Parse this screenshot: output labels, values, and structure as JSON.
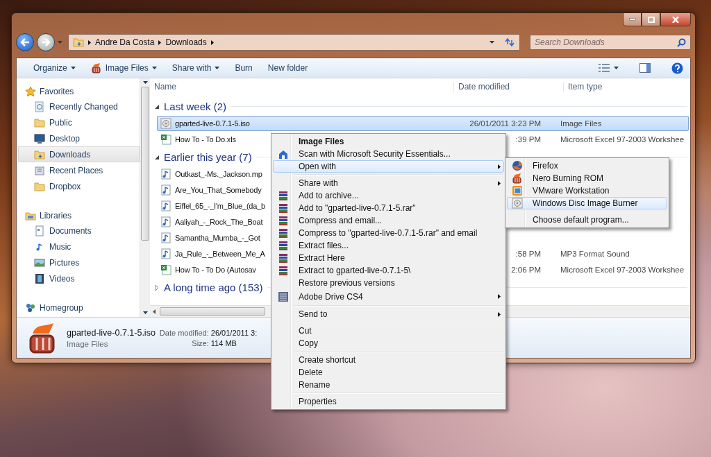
{
  "nav": {
    "breadcrumb": [
      "Andre Da Costa",
      "Downloads"
    ],
    "search": {
      "placeholder": "Search Downloads"
    }
  },
  "toolbar": {
    "items": [
      {
        "label": "Organize",
        "kind": "plain",
        "dropdown": true
      },
      {
        "label": "Image Files",
        "kind": "burner",
        "dropdown": true
      },
      {
        "label": "Share with",
        "kind": "plain",
        "dropdown": true
      },
      {
        "label": "Burn",
        "kind": "plain",
        "dropdown": false
      },
      {
        "label": "New folder",
        "kind": "plain",
        "dropdown": false
      }
    ]
  },
  "sidebar": {
    "sections": [
      {
        "title": "Favorites",
        "kind": "star",
        "items": [
          {
            "label": "Recently Changed",
            "kind": "recent",
            "selected": false
          },
          {
            "label": "Public",
            "kind": "folder",
            "selected": false
          },
          {
            "label": "Desktop",
            "kind": "desktop",
            "selected": false
          },
          {
            "label": "Downloads",
            "kind": "download",
            "selected": true
          },
          {
            "label": "Recent Places",
            "kind": "places",
            "selected": false
          },
          {
            "label": "Dropbox",
            "kind": "folder",
            "selected": false
          }
        ]
      },
      {
        "title": "Libraries",
        "kind": "library",
        "items": [
          {
            "label": "Documents",
            "kind": "document",
            "selected": false
          },
          {
            "label": "Music",
            "kind": "music",
            "selected": false
          },
          {
            "label": "Pictures",
            "kind": "pictures",
            "selected": false
          },
          {
            "label": "Videos",
            "kind": "videos",
            "selected": false
          }
        ]
      },
      {
        "title": "Homegroup",
        "kind": "homegroup"
      }
    ]
  },
  "list": {
    "columns": [
      "Name",
      "Date modified",
      "Item type"
    ],
    "groups": [
      {
        "title": "Last week (2)",
        "expanded": true,
        "files": [
          {
            "name": "gparted-live-0.7.1-5.iso",
            "date": "26/01/2011 3:23 PM",
            "type": "Image Files",
            "kind": "disc",
            "selected": true
          },
          {
            "name": "How To - To Do.xls",
            "date": ":39 PM",
            "type": "Microsoft Excel 97-2003 Workshee",
            "kind": "excel",
            "selected": false
          }
        ]
      },
      {
        "title": "Earlier this year (7)",
        "expanded": true,
        "files": [
          {
            "name": "Outkast_-Ms._Jackson.mp",
            "kind": "audio",
            "selected": false
          },
          {
            "name": "Are_You_That_Somebody",
            "kind": "audio",
            "selected": false
          },
          {
            "name": "Eiffel_65_-_I'm_Blue_(da_b",
            "kind": "audio",
            "selected": false
          },
          {
            "name": "Aaliyah_-_Rock_The_Boat",
            "kind": "audio",
            "selected": false
          },
          {
            "name": "Samantha_Mumba_-_Got",
            "kind": "audio",
            "selected": false
          },
          {
            "name": "Ja_Rule_-_Between_Me_A",
            "date": ":58 PM",
            "type": "MP3 Format Sound",
            "kind": "audio",
            "selected": false
          },
          {
            "name": "How To - To Do (Autosav",
            "date": "2:06 PM",
            "type": "Microsoft Excel 97-2003 Workshee",
            "kind": "excel",
            "selected": false
          }
        ]
      },
      {
        "title": "A long time ago (153)",
        "expanded": false
      }
    ]
  },
  "details": {
    "name": "gparted-live-0.7.1-5.iso",
    "type": "Image Files",
    "fields": [
      {
        "label": "Date modified:",
        "value": "26/01/2011 3:"
      },
      {
        "label": "Size:",
        "value": "114 MB"
      }
    ]
  },
  "context_menu": {
    "sections": [
      {
        "items": [
          {
            "label": "Image Files",
            "kind": "default",
            "submenu": false,
            "selected": false
          },
          {
            "label": "Scan with Microsoft Security Essentials...",
            "kind": "shield",
            "submenu": false,
            "selected": false
          },
          {
            "label": "Open with",
            "kind": "plain",
            "submenu": true,
            "selected": true
          }
        ]
      },
      {
        "items": [
          {
            "label": "Share with",
            "kind": "plain",
            "submenu": true,
            "selected": false
          },
          {
            "label": "Add to archive...",
            "kind": "archive",
            "submenu": false,
            "selected": false
          },
          {
            "label": "Add to \"gparted-live-0.7.1-5.rar\"",
            "kind": "archive",
            "submenu": false,
            "selected": false
          },
          {
            "label": "Compress and email...",
            "kind": "archive",
            "submenu": false,
            "selected": false
          },
          {
            "label": "Compress to \"gparted-live-0.7.1-5.rar\" and email",
            "kind": "archive",
            "submenu": false,
            "selected": false
          },
          {
            "label": "Extract files...",
            "kind": "archive",
            "submenu": false,
            "selected": false
          },
          {
            "label": "Extract Here",
            "kind": "archive",
            "submenu": false,
            "selected": false
          },
          {
            "label": "Extract to gparted-live-0.7.1-5\\",
            "kind": "archive",
            "submenu": false,
            "selected": false
          },
          {
            "label": "Restore previous versions",
            "kind": "plain",
            "submenu": false,
            "selected": false
          },
          {
            "label": "Adobe Drive CS4",
            "kind": "drive",
            "submenu": true,
            "selected": false
          }
        ]
      },
      {
        "items": [
          {
            "label": "Send to",
            "kind": "plain",
            "submenu": true,
            "selected": false
          }
        ]
      },
      {
        "items": [
          {
            "label": "Cut",
            "kind": "plain",
            "submenu": false,
            "selected": false
          },
          {
            "label": "Copy",
            "kind": "plain",
            "submenu": false,
            "selected": false
          }
        ]
      },
      {
        "items": [
          {
            "label": "Create shortcut",
            "kind": "plain",
            "submenu": false,
            "selected": false
          },
          {
            "label": "Delete",
            "kind": "plain",
            "submenu": false,
            "selected": false
          },
          {
            "label": "Rename",
            "kind": "plain",
            "submenu": false,
            "selected": false
          }
        ]
      },
      {
        "items": [
          {
            "label": "Properties",
            "kind": "plain",
            "submenu": false,
            "selected": false
          }
        ]
      }
    ]
  },
  "open_with_menu": {
    "sections": [
      {
        "items": [
          {
            "label": "Firefox",
            "kind": "browser",
            "selected": false
          },
          {
            "label": "Nero Burning ROM",
            "kind": "burner",
            "selected": false
          },
          {
            "label": "VMware Workstation",
            "kind": "vm",
            "selected": false
          },
          {
            "label": "Windows Disc Image Burner",
            "kind": "disc",
            "selected": true
          }
        ]
      },
      {
        "items": [
          {
            "label": "Choose default program...",
            "kind": "plain",
            "selected": false
          }
        ]
      }
    ]
  }
}
